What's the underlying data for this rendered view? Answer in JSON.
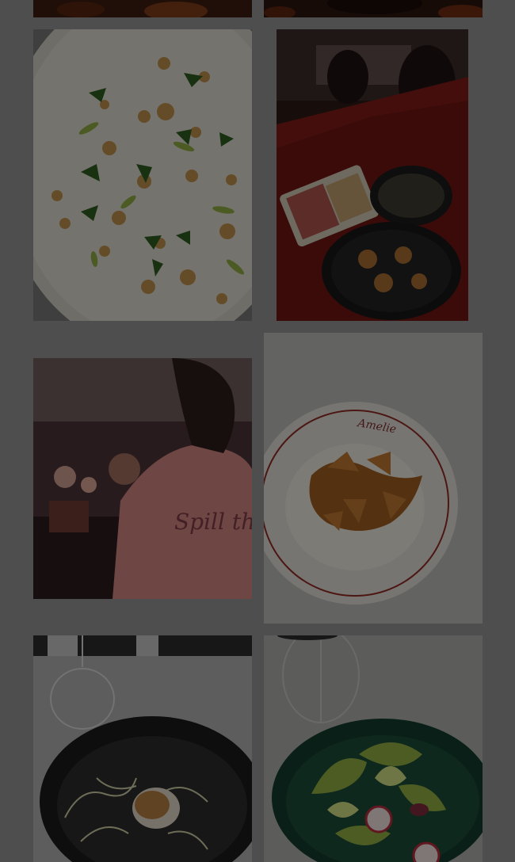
{
  "gallery": {
    "overlay_color": "#000000",
    "photos": [
      {
        "name": "dark-bar-photo-left"
      },
      {
        "name": "dark-bar-photo-right"
      },
      {
        "name": "scallop-carpaccio-photo"
      },
      {
        "name": "bar-table-dishes-photo"
      },
      {
        "name": "server-shirt-photo"
      },
      {
        "name": "pasta-plate-photo"
      },
      {
        "name": "frisee-bowl-photo"
      },
      {
        "name": "green-salad-bowl-photo"
      }
    ],
    "shirt_text": "Spill the Wine",
    "plate_text": "Amelie"
  }
}
